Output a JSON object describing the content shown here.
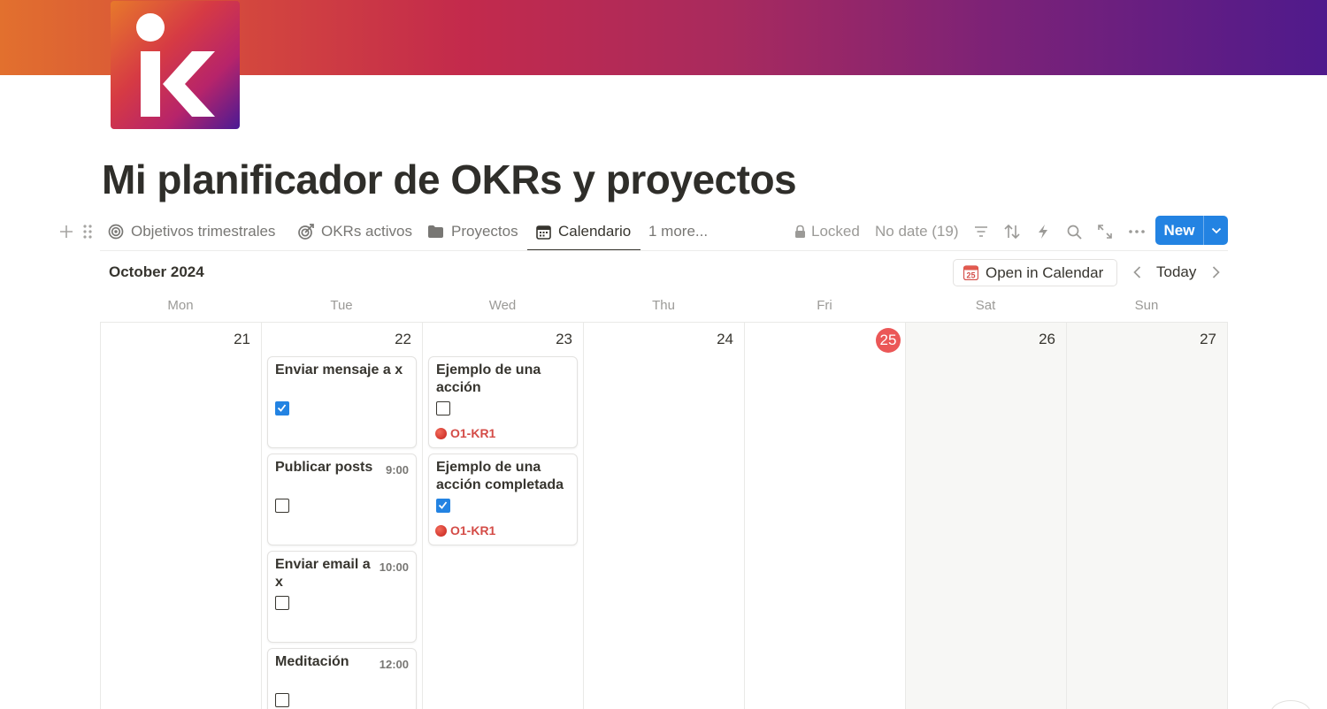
{
  "page": {
    "title": "Mi planificador de OKRs y proyectos"
  },
  "colors": {
    "accent": "#2383e2",
    "today": "#eb5757",
    "kr_text": "#d44c47"
  },
  "toolbar": {
    "tabs": [
      {
        "label": "Objetivos trimestrales",
        "icon": "target-icon"
      },
      {
        "label": "OKRs activos",
        "icon": "target-arrow-icon"
      },
      {
        "label": "Proyectos",
        "icon": "folder-icon"
      },
      {
        "label": "Calendario",
        "icon": "calendar-icon",
        "active": true
      }
    ],
    "more_label": "1 more...",
    "locked_label": "Locked",
    "no_date_label": "No date (19)",
    "new_label": "New"
  },
  "calendar": {
    "month_label": "October 2024",
    "open_in_calendar_label": "Open in Calendar",
    "open_in_calendar_icon_text": "25",
    "today_label": "Today",
    "weekdays": [
      "Mon",
      "Tue",
      "Wed",
      "Thu",
      "Fri",
      "Sat",
      "Sun"
    ],
    "days": [
      "21",
      "22",
      "23",
      "24",
      "25",
      "26",
      "27"
    ],
    "today_day": "25"
  },
  "events": {
    "tue": [
      {
        "title": "Enviar mensaje a x",
        "time": "",
        "checked": true
      },
      {
        "title": "Publicar posts",
        "time": "9:00",
        "checked": false
      },
      {
        "title": "Enviar email a x",
        "time": "10:00",
        "checked": false
      },
      {
        "title": "Meditación",
        "time": "12:00",
        "checked": false
      }
    ],
    "wed": [
      {
        "title": "Ejemplo de una acción",
        "checked": false,
        "kr": "O1-KR1"
      },
      {
        "title": "Ejemplo de una acción completada",
        "checked": true,
        "kr": "O1-KR1"
      }
    ]
  }
}
